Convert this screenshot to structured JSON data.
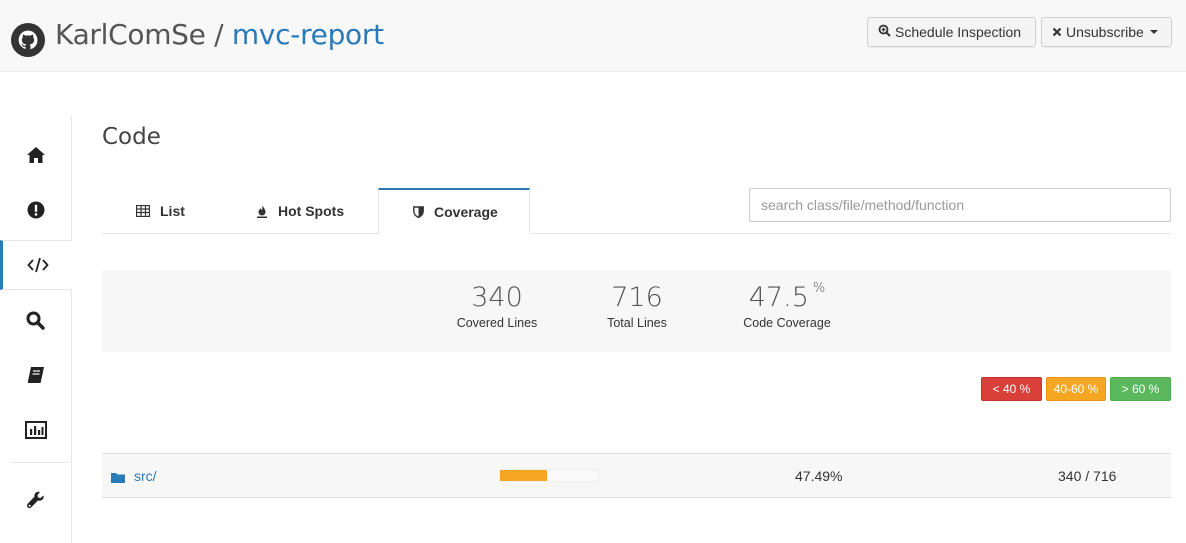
{
  "header": {
    "owner": "KarlComSe",
    "separator": " / ",
    "repo": "mvc-report",
    "schedule_label": "Schedule Inspection",
    "unsubscribe_label": "Unsubscribe"
  },
  "sidebar": {
    "items": [
      {
        "icon": "home-icon"
      },
      {
        "icon": "issues-icon"
      },
      {
        "icon": "code-icon",
        "active": true
      },
      {
        "icon": "search-icon"
      },
      {
        "icon": "book-icon"
      },
      {
        "icon": "chart-icon"
      },
      {
        "icon": "wrench-icon"
      }
    ]
  },
  "page": {
    "title": "Code"
  },
  "tabs": [
    {
      "label": "List",
      "icon": "table-icon"
    },
    {
      "label": "Hot Spots",
      "icon": "fire-icon"
    },
    {
      "label": "Coverage",
      "icon": "shield-icon",
      "active": true
    }
  ],
  "search": {
    "placeholder": "search class/file/method/function",
    "value": ""
  },
  "stats": {
    "covered_value": "340",
    "covered_label": "Covered Lines",
    "total_value": "716",
    "total_label": "Total Lines",
    "coverage_value": "47.5",
    "coverage_unit": "%",
    "coverage_label": "Code Coverage"
  },
  "legend": {
    "low": "< 40 %",
    "mid": "40-60 %",
    "high": "> 60 %"
  },
  "rows": [
    {
      "name": "src/",
      "coverage_fraction": 0.4749,
      "percent": "47.49%",
      "ratio": "340 / 716"
    }
  ],
  "colors": {
    "accent": "#2a7ab8",
    "low": "#d9403a",
    "mid": "#f5a623",
    "high": "#5cb85c"
  }
}
